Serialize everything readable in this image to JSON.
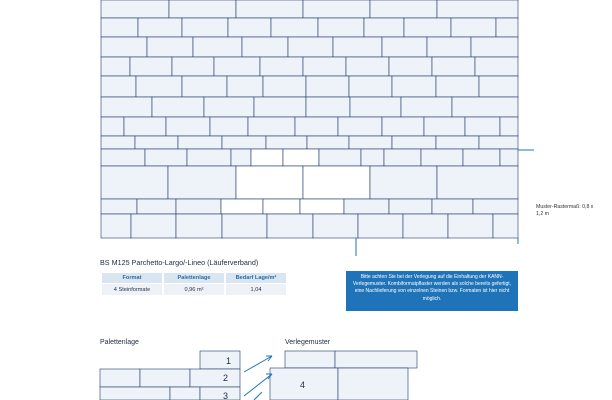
{
  "pattern": {
    "side_label": "Muster-Rastermaß: 0,8 x 1,2 m"
  },
  "product": {
    "heading": "BS M125 Parchetto-Largo/-Lineo (Läuferverband)"
  },
  "table": {
    "headers": [
      "Format",
      "Palettenlage",
      "Bedarf Lage/m²"
    ],
    "rows": [
      [
        "4 Steinformate",
        "0,96 m²",
        "1,04"
      ]
    ]
  },
  "note": {
    "text": "Bitte achten Sie bei der Verlegung auf die Einhaltung der KANN-Verlegemuster. Kombiformatpflaster werden als solche bereits gefertigt, eine Nachlieferung von einzelnen Steinen bzw. Formaten ist hier nicht möglich."
  },
  "palette": {
    "title": "Palettenlage",
    "numbers": [
      "1",
      "2",
      "3"
    ]
  },
  "verlegemuster": {
    "title": "Verlegemuster",
    "number": "4"
  },
  "colors": {
    "stone_fill": "#eef3f9",
    "stone_stroke": "#1f3a66",
    "accent_blue": "#1f74b9",
    "header_fill": "#d9e6f1"
  }
}
